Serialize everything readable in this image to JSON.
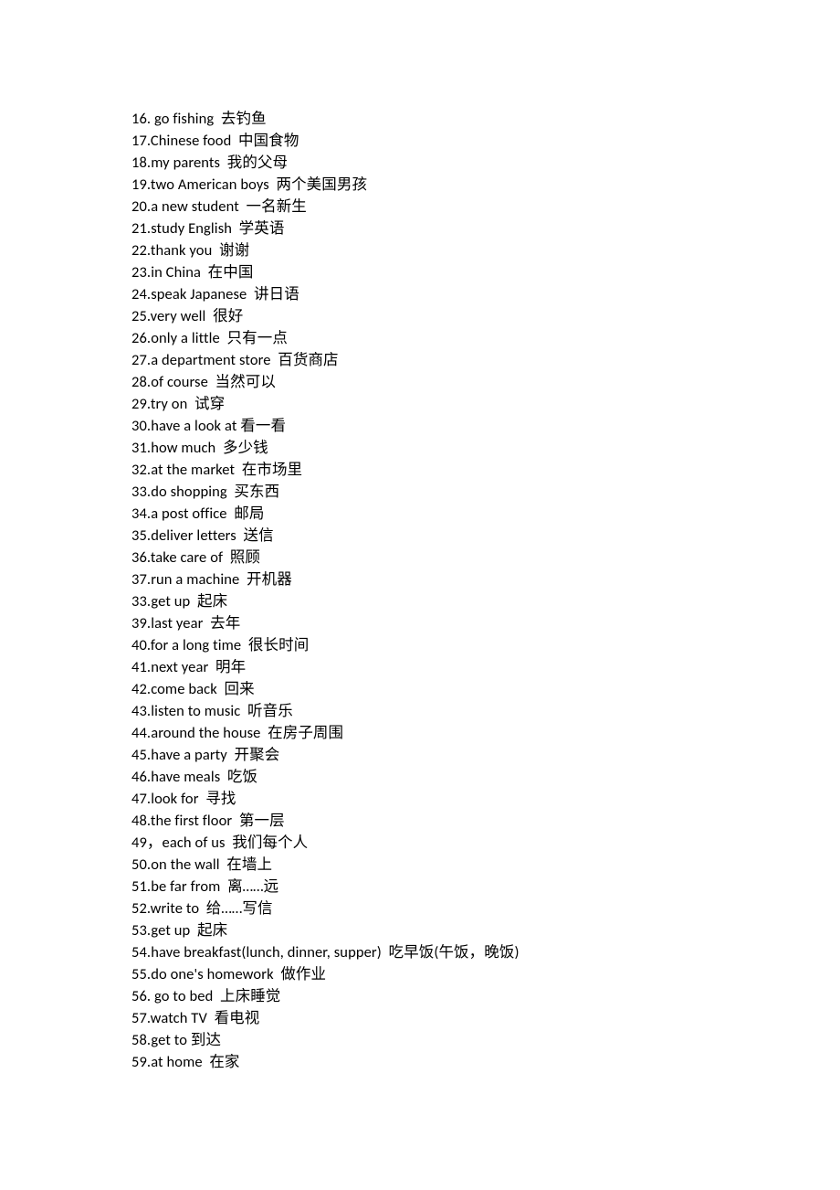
{
  "lines": [
    "16. go fishing  去钓鱼",
    "17.Chinese food  中国食物",
    "18.my parents  我的父母",
    "19.two American boys  两个美国男孩",
    "20.a new student  一名新生",
    "21.study English  学英语",
    "22.thank you  谢谢",
    "23.in China  在中国",
    "24.speak Japanese  讲日语",
    "25.very well  很好",
    "26.only a little  只有一点",
    "27.a department store  百货商店",
    "28.of course  当然可以",
    "29.try on  试穿",
    "30.have a look at 看一看",
    "31.how much  多少钱",
    "32.at the market  在市场里",
    "33.do shopping  买东西",
    "34.a post office  邮局",
    "35.deliver letters  送信",
    "36.take care of  照顾",
    "37.run a machine  开机器",
    "33.get up  起床",
    "39.last year  去年",
    "40.for a long time  很长时间",
    "41.next year  明年",
    "42.come back  回来",
    "43.listen to music  听音乐",
    "44.around the house  在房子周围",
    "45.have a party  开聚会",
    "46.have meals  吃饭",
    "47.look for  寻找",
    "48.the first floor  第一层",
    "49，each of us  我们每个人",
    "50.on the wall  在墙上",
    "51.be far from  离……远",
    "52.write to  给……写信",
    "53.get up  起床",
    "54.have breakfast(lunch, dinner, supper)  吃早饭(午饭，晚饭)",
    "55.do one's homework  做作业",
    "56. go to bed  上床睡觉",
    "57.watch TV  看电视",
    "58.get to 到达",
    "59.at home  在家"
  ]
}
